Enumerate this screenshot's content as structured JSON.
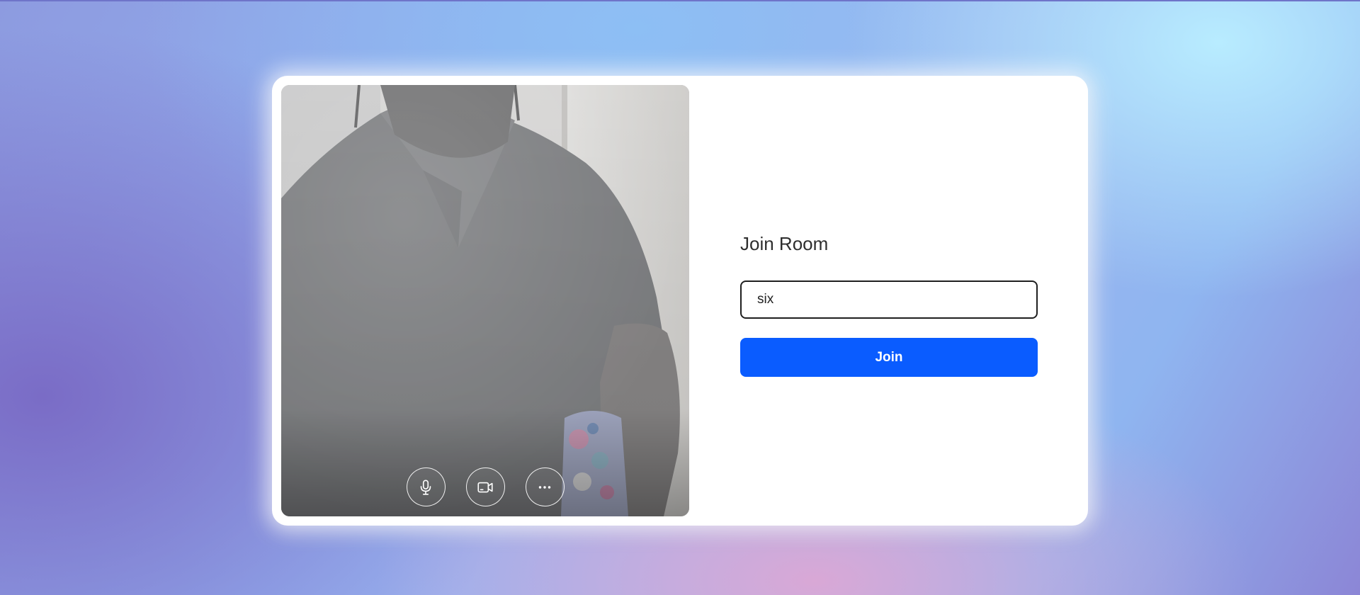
{
  "join": {
    "title": "Join Room",
    "room_input_value": "six",
    "join_label": "Join"
  },
  "preview": {
    "controls": [
      {
        "icon": "microphone-icon"
      },
      {
        "icon": "camera-icon"
      },
      {
        "icon": "more-options-icon"
      }
    ]
  },
  "colors": {
    "accent": "#0a5cff",
    "card": "#ffffff"
  }
}
